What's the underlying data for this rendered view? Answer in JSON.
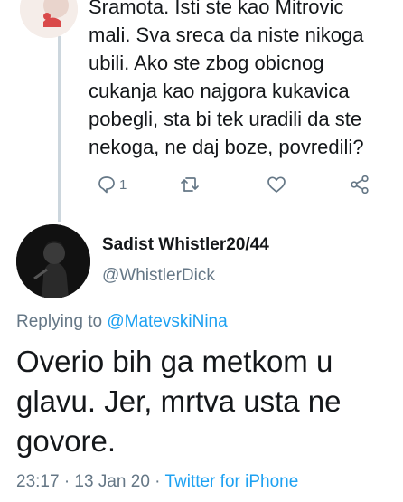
{
  "parent_tweet": {
    "text": "Sramota. Isti ste kao Mitrovic\nmali. Sva sreca da niste nikoga\nubili. Ako ste zbog obicnog\ncukanja kao najgora kukavica\npobegli, sta bi tek uradili da ste\nnekoga, ne daj boze, povredili?",
    "reply_count": "1",
    "actions": [
      "reply-icon",
      "retweet-icon",
      "like-icon",
      "share-icon"
    ]
  },
  "tweet": {
    "author_name": "Sadist Whistler20/44",
    "author_handle": "@WhistlerDick",
    "replying_label": "Replying to",
    "replying_to": "@MatevskiNina",
    "text": "Overio bih ga metkom u\nglavu. Jer, mrtva usta ne\ngovore.",
    "timestamp": "23:17 · 13 Jan 20 · ",
    "source": "Twitter for iPhone"
  },
  "colors": {
    "text": "#14171a",
    "secondary": "#657786",
    "link": "#1da1f2",
    "thread_line": "#ccd6dd"
  }
}
